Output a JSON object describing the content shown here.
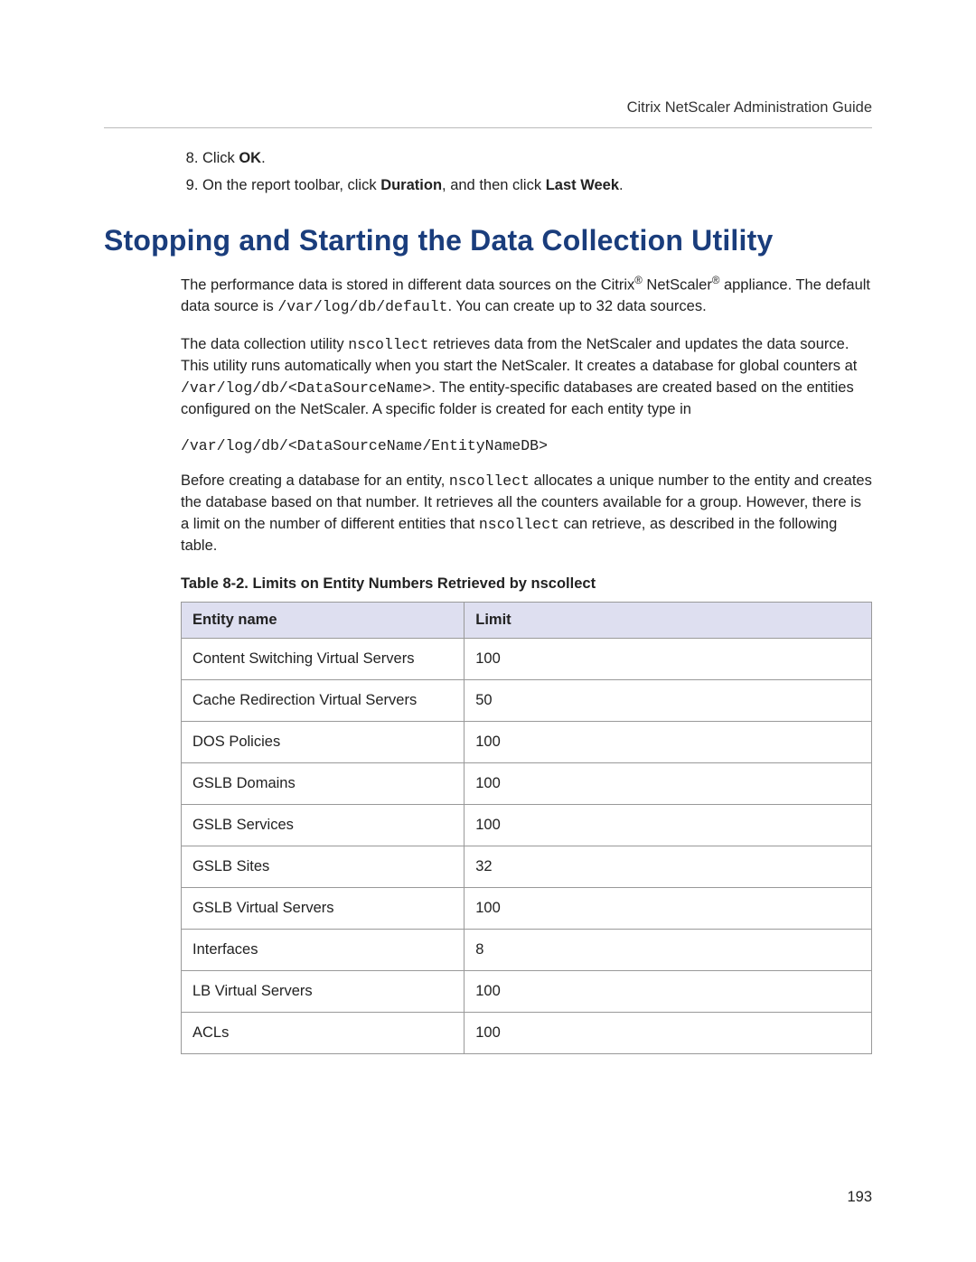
{
  "header": {
    "running_head": "Citrix NetScaler Administration Guide"
  },
  "steps": {
    "start": 8,
    "items": [
      {
        "pre": "Click ",
        "bold": "OK",
        "post": "."
      },
      {
        "pre": "On the report toolbar, click ",
        "bold": "Duration",
        "mid": ", and then click ",
        "bold2": "Last Week",
        "post": "."
      }
    ]
  },
  "heading": "Stopping and Starting the Data Collection Utility",
  "paragraphs": {
    "p1_a": "The performance data is stored in different data sources on the Citrix",
    "p1_reg1": "®",
    "p1_b": " NetScaler",
    "p1_reg2": "®",
    "p1_c": " appliance. The default data source is ",
    "p1_code": "/var/log/db/default",
    "p1_d": ". You can create up to 32 data sources.",
    "p2_a": "The data collection utility ",
    "p2_code1": "nscollect",
    "p2_b": " retrieves data from the NetScaler and updates the data source. This utility runs automatically when you start the NetScaler. It creates a database for global counters at ",
    "p2_code2": "/var/log/db/<DataSourceName>",
    "p2_c": ". The entity-specific databases are created based on the entities configured on the NetScaler. A specific folder is created for each entity type in",
    "code_line": "/var/log/db/<DataSourceName/EntityNameDB>",
    "p3_a": "Before creating a database for an entity, ",
    "p3_code1": "nscollect",
    "p3_b": " allocates a unique number to the entity and creates the database based on that number. It retrieves all the counters available for a group. However, there is a limit on the number of different entities that ",
    "p3_code2": "nscollect",
    "p3_c": " can retrieve, as described in the following table."
  },
  "table": {
    "caption": "Table 8-2. Limits on Entity Numbers Retrieved by nscollect",
    "headers": {
      "col1": "Entity name",
      "col2": "Limit"
    },
    "rows": [
      {
        "name": "Content Switching Virtual Servers",
        "limit": "100"
      },
      {
        "name": "Cache Redirection Virtual Servers",
        "limit": "50"
      },
      {
        "name": "DOS Policies",
        "limit": "100"
      },
      {
        "name": "GSLB Domains",
        "limit": "100"
      },
      {
        "name": "GSLB Services",
        "limit": "100"
      },
      {
        "name": "GSLB Sites",
        "limit": "32"
      },
      {
        "name": "GSLB Virtual Servers",
        "limit": "100"
      },
      {
        "name": "Interfaces",
        "limit": "8"
      },
      {
        "name": "LB Virtual Servers",
        "limit": "100"
      },
      {
        "name": "ACLs",
        "limit": "100"
      }
    ]
  },
  "page_number": "193"
}
